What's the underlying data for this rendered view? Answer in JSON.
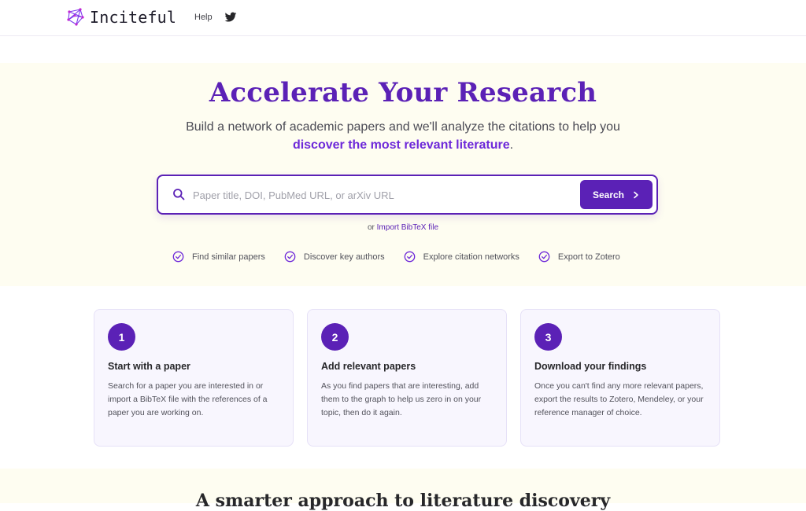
{
  "header": {
    "brand_name": "Inciteful",
    "help_label": "Help",
    "twitter_icon": "twitter-icon"
  },
  "hero": {
    "title": "Accelerate Your Research",
    "subtitle_part1": "Build a network of academic papers and we'll analyze the citations to help you ",
    "subtitle_highlight": "discover the most relevant literature",
    "subtitle_end": "."
  },
  "search": {
    "placeholder": "Paper title, DOI, PubMed URL, or arXiv URL",
    "value": "",
    "button_label": "Search"
  },
  "import": {
    "prefix": "or",
    "link_label": "Import BibTeX file"
  },
  "features": [
    {
      "label": "Find similar papers"
    },
    {
      "label": "Discover key authors"
    },
    {
      "label": "Explore citation networks"
    },
    {
      "label": "Export to Zotero"
    }
  ],
  "steps": [
    {
      "number": "1",
      "title": "Start with a paper",
      "text": "Search for a paper you are interested in or import a BibTeX file with the references of a paper you are working on."
    },
    {
      "number": "2",
      "title": "Add relevant papers",
      "text": "As you find papers that are interesting, add them to the graph to help us zero in on your topic, then do it again."
    },
    {
      "number": "3",
      "title": "Download your findings",
      "text": "Once you can't find any more relevant papers, export the results to Zotero, Mendeley, or your reference manager of choice."
    }
  ],
  "bottom": {
    "title": "A smarter approach to literature discovery"
  },
  "colors": {
    "accent": "#5b21b6",
    "hero_bg": "#fefdf1",
    "card_bg": "#f8f6fe"
  }
}
